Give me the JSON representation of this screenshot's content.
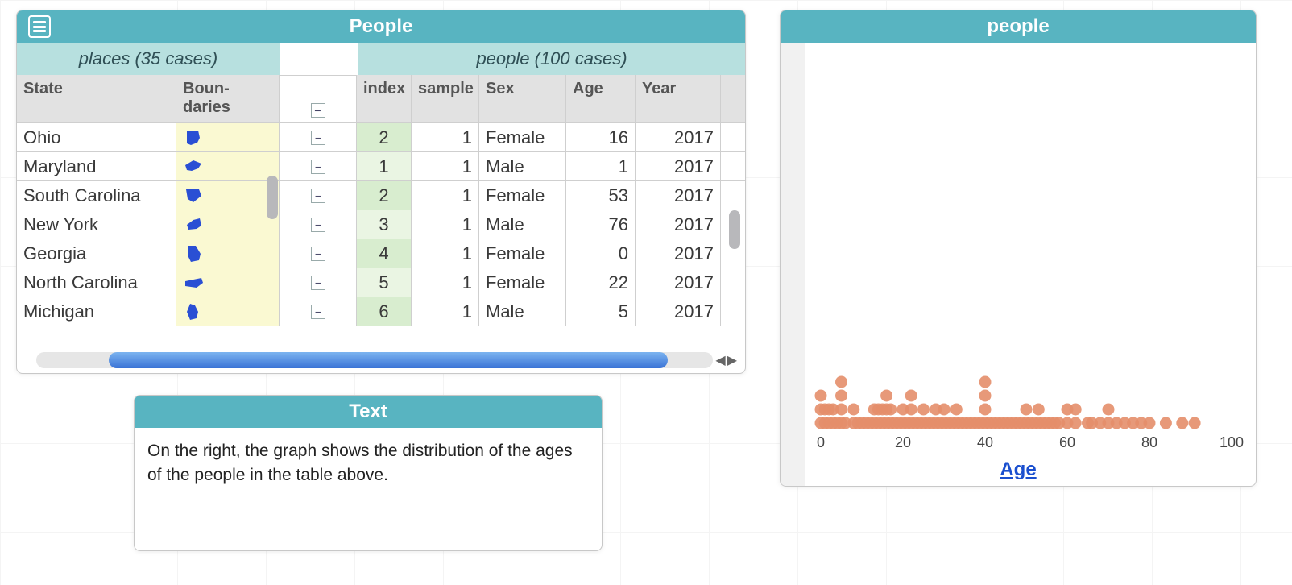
{
  "people_tile": {
    "title": "People",
    "sub_left": "places (35 cases)",
    "sub_right": "people (100 cases)",
    "columns_left": [
      "State",
      "Boun-\ndaries"
    ],
    "columns_right": [
      "index",
      "sample",
      "Sex",
      "Age",
      "Year"
    ],
    "states": [
      {
        "name": "Ohio"
      },
      {
        "name": "Maryland"
      },
      {
        "name": "South Carolina"
      },
      {
        "name": "New York"
      },
      {
        "name": "Georgia"
      },
      {
        "name": "North Carolina"
      },
      {
        "name": "Michigan"
      }
    ],
    "people_rows": [
      {
        "index": 2,
        "sample": 1,
        "sex": "Female",
        "age": 16,
        "year": 2017
      },
      {
        "index": 1,
        "sample": 1,
        "sex": "Male",
        "age": 1,
        "year": 2017
      },
      {
        "index": 2,
        "sample": 1,
        "sex": "Female",
        "age": 53,
        "year": 2017
      },
      {
        "index": 3,
        "sample": 1,
        "sex": "Male",
        "age": 76,
        "year": 2017
      },
      {
        "index": 4,
        "sample": 1,
        "sex": "Female",
        "age": 0,
        "year": 2017
      },
      {
        "index": 5,
        "sample": 1,
        "sex": "Female",
        "age": 22,
        "year": 2017
      },
      {
        "index": 6,
        "sample": 1,
        "sex": "Male",
        "age": 5,
        "year": 2017
      }
    ]
  },
  "text_tile": {
    "title": "Text",
    "body": "On the right, the graph shows the distribution of the ages of the people in the table above."
  },
  "graph_tile": {
    "title": "people",
    "xlabel": "Age",
    "ticks": [
      0,
      20,
      40,
      60,
      80,
      100
    ]
  },
  "chart_data": {
    "type": "scatter",
    "title": "people",
    "xlabel": "Age",
    "ylabel": "",
    "xlim": [
      0,
      100
    ],
    "ylim": [
      0,
      9
    ],
    "note": "dot plot of 100 ages; y is stacking count per age bin",
    "ticks_x": [
      0,
      20,
      40,
      60,
      80,
      100
    ],
    "point_color_hex": "#e48e6a",
    "ages": [
      0,
      0,
      0,
      1,
      1,
      2,
      2,
      3,
      3,
      4,
      5,
      5,
      5,
      5,
      6,
      8,
      8,
      9,
      10,
      11,
      12,
      13,
      13,
      14,
      14,
      15,
      15,
      16,
      16,
      16,
      17,
      17,
      18,
      19,
      20,
      20,
      21,
      22,
      22,
      22,
      23,
      24,
      25,
      25,
      26,
      27,
      28,
      28,
      29,
      30,
      30,
      31,
      32,
      33,
      33,
      34,
      35,
      36,
      37,
      38,
      39,
      40,
      40,
      40,
      40,
      41,
      42,
      43,
      44,
      45,
      46,
      47,
      48,
      49,
      50,
      50,
      51,
      52,
      53,
      53,
      54,
      55,
      56,
      57,
      58,
      60,
      60,
      62,
      62,
      65,
      66,
      68,
      70,
      70,
      72,
      74,
      76,
      78,
      80,
      84,
      88,
      91
    ]
  }
}
